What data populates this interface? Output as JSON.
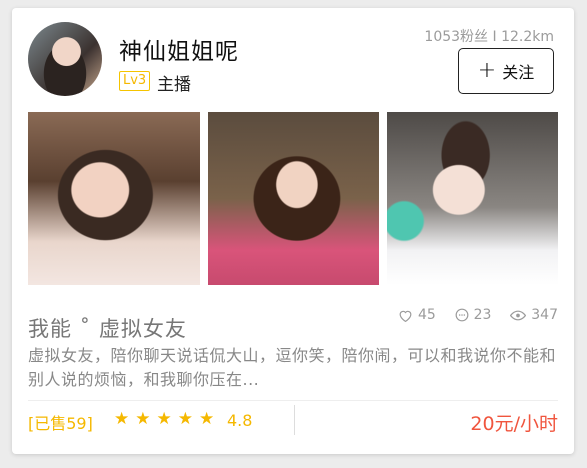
{
  "profile": {
    "name": "神仙姐姐呢",
    "level": "Lv3",
    "role": "主播",
    "stats": "1053粉丝 I 12.2km",
    "follow_label": "关注"
  },
  "photos": [
    "photo-1",
    "photo-2",
    "photo-3"
  ],
  "engagement": {
    "likes": "45",
    "comments": "23",
    "views": "347"
  },
  "service": {
    "title": "我能 ˚ 虚拟女友",
    "description": "虚拟女友，陪你聊天说话侃大山，逗你笑，陪你闹，可以和我说你不能和别人说的烦恼，和我聊你压在..."
  },
  "footer": {
    "sold": "[已售59]",
    "stars": 5,
    "rating": "4.8",
    "price": "20元/小时"
  },
  "colors": {
    "accent": "#f5b800",
    "price": "#f0553e"
  }
}
